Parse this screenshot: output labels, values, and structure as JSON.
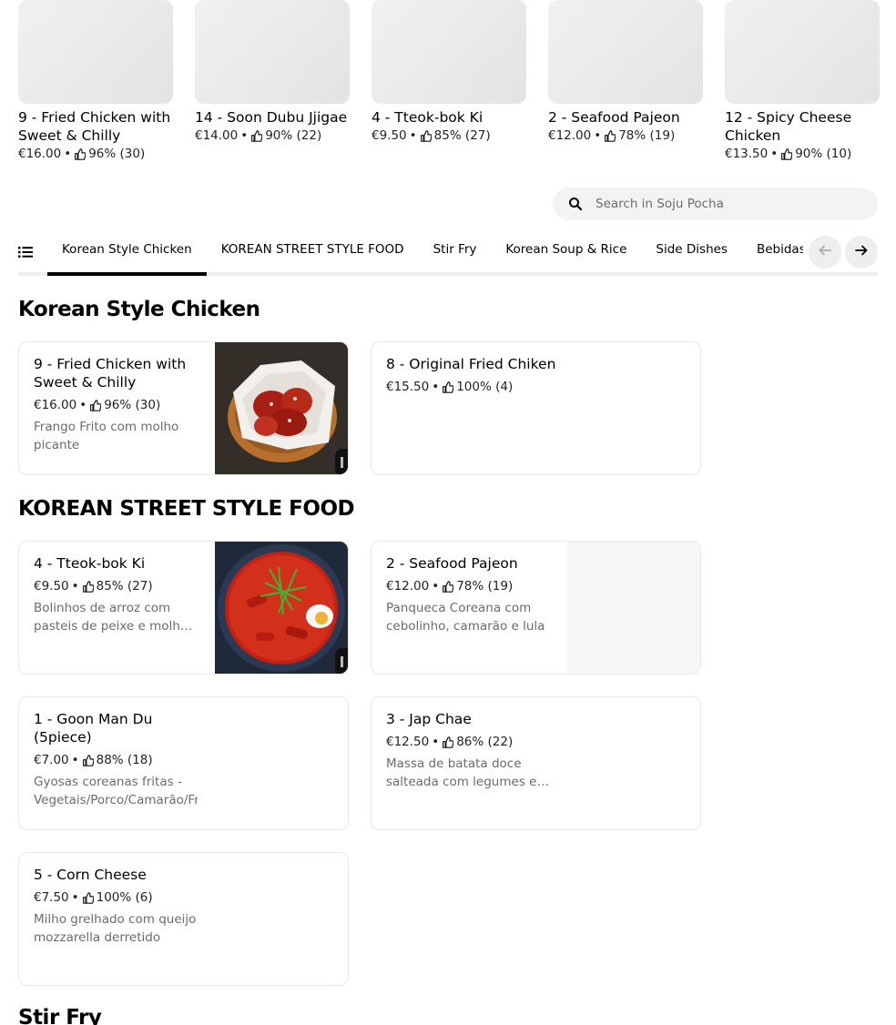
{
  "carousel": [
    {
      "name": "9 - Fried Chicken with Sweet & Chilly",
      "price": "€16.00",
      "rating": "96% (30)"
    },
    {
      "name": "14 - Soon Dubu Jjigae",
      "price": "€14.00",
      "rating": "90% (22)"
    },
    {
      "name": "4 - Tteok-bok Ki",
      "price": "€9.50",
      "rating": "85% (27)"
    },
    {
      "name": "2 - Seafood Pajeon",
      "price": "€12.00",
      "rating": "78% (19)"
    },
    {
      "name": "12 - Spicy Cheese Chicken",
      "price": "€13.50",
      "rating": "90% (10)"
    }
  ],
  "separator": "•",
  "search": {
    "placeholder": "Search in Soju Pocha"
  },
  "tabs": [
    "Korean Style Chicken",
    "KOREAN STREET STYLE FOOD",
    "Stir Fry",
    "Korean Soup & Rice",
    "Side Dishes",
    "Bebidas"
  ],
  "active_tab": "Korean Style Chicken",
  "sections": [
    {
      "title": "Korean Style Chicken",
      "items": [
        {
          "name": "9 - Fried Chicken with Sweet & Chilly",
          "price": "€16.00",
          "rating": "96% (30)",
          "description": "Frango Frito com molho picante"
        },
        {
          "name": "8 - Original Fried Chiken",
          "price": "€15.50",
          "rating": "100% (4)",
          "description": ""
        }
      ]
    },
    {
      "title": "KOREAN STREET STYLE FOOD",
      "items": [
        {
          "name": "4 - Tteok-bok Ki",
          "price": "€9.50",
          "rating": "85% (27)",
          "description": "Bolinhos de arroz com pasteis de peixe e molho picante"
        },
        {
          "name": "2 - Seafood Pajeon",
          "price": "€12.00",
          "rating": "78% (19)",
          "description": "Panqueca Coreana com cebolinho, camarão e lula"
        },
        {
          "name": "1 - Goon Man Du (5piece)",
          "price": "€7.00",
          "rating": "88% (18)",
          "description": "Gyosas coreanas fritas - Vegetais/Porco/Camarão/Frango"
        },
        {
          "name": "3 - Jap Chae",
          "price": "€12.50",
          "rating": "86% (22)",
          "description": "Massa de batata doce salteada com legumes e carne"
        },
        {
          "name": "5 - Corn Cheese",
          "price": "€7.50",
          "rating": "100% (6)",
          "description": "Milho grelhado com queijo mozzarella derretido"
        }
      ]
    },
    {
      "title": "Stir Fry"
    }
  ],
  "colors": {
    "accent": "#000000",
    "muted": "#6b6b6b",
    "pill_bg": "#f3f3f3"
  }
}
